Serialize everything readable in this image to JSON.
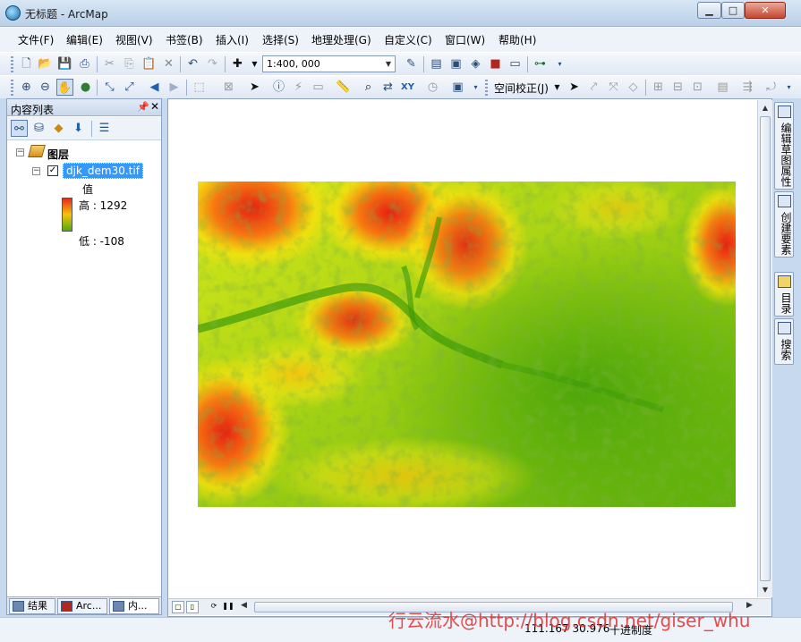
{
  "window": {
    "title": "无标题 - ArcMap"
  },
  "menu": [
    "文件(F)",
    "编辑(E)",
    "视图(V)",
    "书签(B)",
    "插入(I)",
    "选择(S)",
    "地理处理(G)",
    "自定义(C)",
    "窗口(W)",
    "帮助(H)"
  ],
  "toolbar": {
    "scale": "1:400, 000",
    "georef_label": "空间校正(J)"
  },
  "toc": {
    "title": "内容列表",
    "root_label": "图层",
    "layer": {
      "name": "djk_dem30.tif",
      "checked": true,
      "legend_title": "值",
      "high": "高 : 1292",
      "low": "低 : -108"
    },
    "tabs": [
      "结果",
      "Arc...",
      "内..."
    ]
  },
  "right_dock": [
    "编辑草图属性",
    "创建要素",
    "目录",
    "搜索"
  ],
  "status": {
    "coords": "111.167  30.976",
    "units": "十进制度"
  },
  "watermark": "行云流水@http://blog.csdn.net/giser_whu",
  "colors": {
    "ramp_high": "#e52a1a",
    "ramp_mid": "#f7c20a",
    "ramp_low": "#4faa10"
  }
}
